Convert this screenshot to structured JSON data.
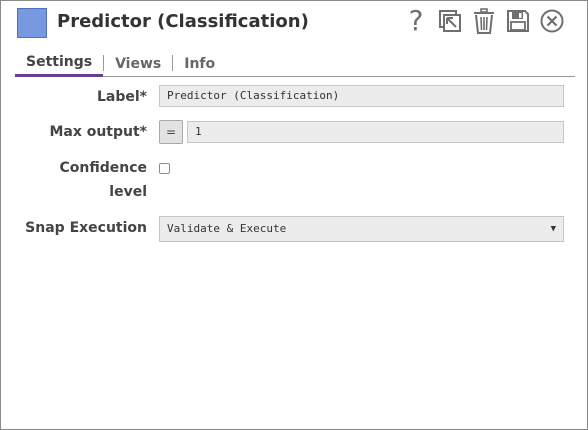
{
  "header": {
    "title": "Predictor (Classification)",
    "swatch_color": "#7899e0",
    "tools": [
      "help-icon",
      "export-icon",
      "delete-icon",
      "save-icon",
      "close-icon"
    ],
    "help_glyph": "?"
  },
  "tabs": [
    {
      "label": "Settings",
      "active": true
    },
    {
      "label": "Views",
      "active": false
    },
    {
      "label": "Info",
      "active": false
    }
  ],
  "accent_color": "#6a3d8f",
  "form": {
    "label_field": {
      "label": "Label*",
      "value": "Predictor (Classification)"
    },
    "max_output": {
      "label": "Max output*",
      "expr_label": "=",
      "value": "1"
    },
    "confidence": {
      "label_line1": "Confidence",
      "label_line2": "level",
      "checked": false
    },
    "snap_execution": {
      "label": "Snap Execution",
      "value": "Validate & Execute",
      "arrow": "▼"
    }
  }
}
